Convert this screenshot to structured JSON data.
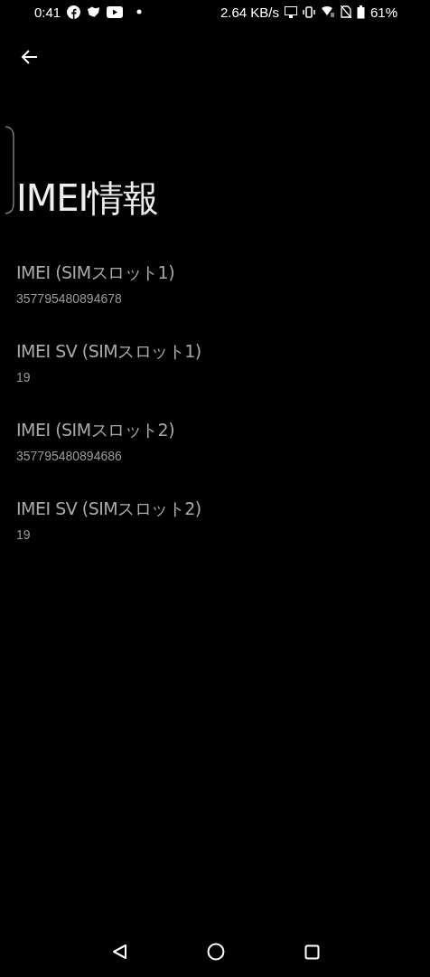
{
  "status_bar": {
    "time": "0:41",
    "speed": "2.64 KB/s",
    "battery": "61%"
  },
  "title": "IMEI情報",
  "items": [
    {
      "label": "IMEI (SIMスロット1)",
      "value": "357795480894678"
    },
    {
      "label": "IMEI SV (SIMスロット1)",
      "value": "19"
    },
    {
      "label": "IMEI (SIMスロット2)",
      "value": "357795480894686"
    },
    {
      "label": "IMEI SV (SIMスロット2)",
      "value": "19"
    }
  ]
}
